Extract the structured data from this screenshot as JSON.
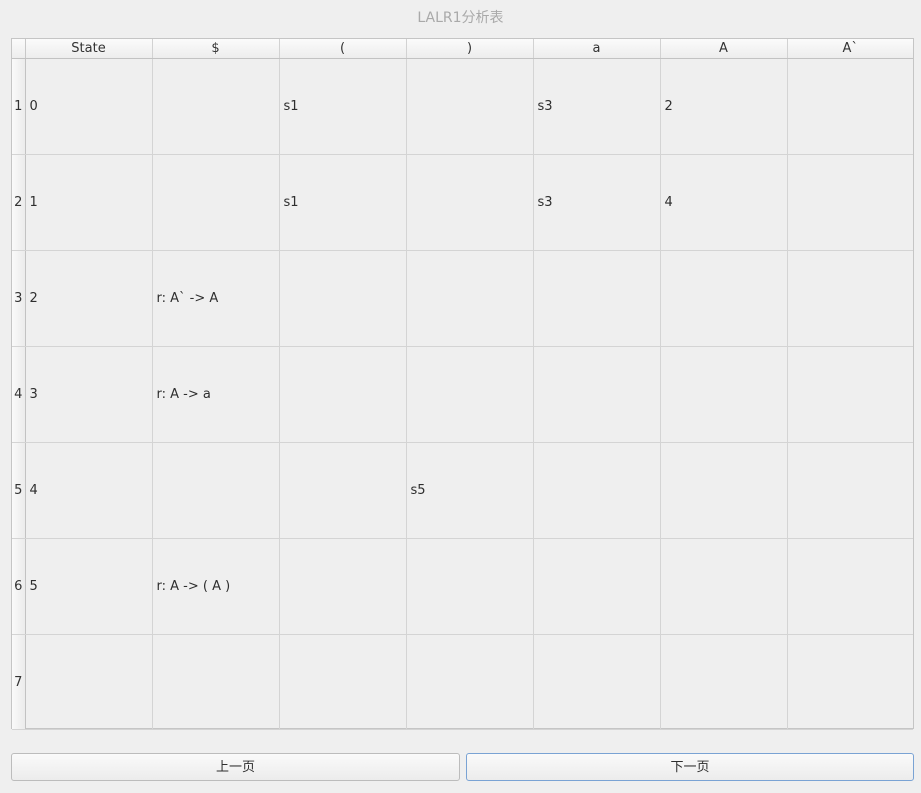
{
  "window": {
    "title": "LALR1分析表"
  },
  "table": {
    "columns": [
      "State",
      "$",
      "(",
      ")",
      "a",
      "A",
      "A`"
    ],
    "rows": [
      {
        "header": "1",
        "cells": [
          "0",
          "",
          "s1",
          "",
          "s3",
          "2",
          ""
        ]
      },
      {
        "header": "2",
        "cells": [
          "1",
          "",
          "s1",
          "",
          "s3",
          "4",
          ""
        ]
      },
      {
        "header": "3",
        "cells": [
          "2",
          "r: A` -> A",
          "",
          "",
          "",
          "",
          ""
        ]
      },
      {
        "header": "4",
        "cells": [
          "3",
          "r: A -> a",
          "",
          "",
          "",
          "",
          ""
        ]
      },
      {
        "header": "5",
        "cells": [
          "4",
          "",
          "",
          "s5",
          "",
          "",
          ""
        ]
      },
      {
        "header": "6",
        "cells": [
          "5",
          "r: A -> ( A )",
          "",
          "",
          "",
          "",
          ""
        ]
      },
      {
        "header": "7",
        "cells": [
          "",
          "",
          "",
          "",
          "",
          "",
          ""
        ]
      }
    ]
  },
  "buttons": {
    "prev_label": "上一页",
    "next_label": "下一页"
  }
}
